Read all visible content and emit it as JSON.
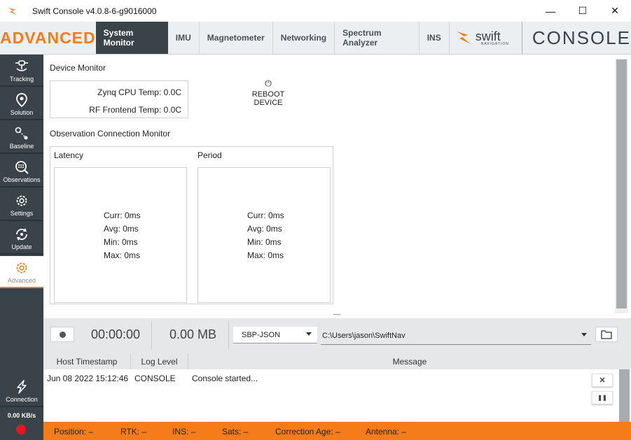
{
  "window": {
    "title": "Swift Console v4.0.8-6-g9016000",
    "minimize": "—",
    "maximize": "☐",
    "close": "✕"
  },
  "topnav": {
    "mode": "ADVANCED",
    "tabs": [
      {
        "label": "System Monitor",
        "active": true
      },
      {
        "label": "IMU"
      },
      {
        "label": "Magnetometer"
      },
      {
        "label": "Networking"
      },
      {
        "label": "Spectrum Analyzer"
      },
      {
        "label": "INS"
      }
    ],
    "logo_word": "swift",
    "logo_sub": "NAVIGATION",
    "console_word": "CONSOLE"
  },
  "sidebar": {
    "items": [
      {
        "label": "Tracking",
        "icon": "satellite-icon"
      },
      {
        "label": "Solution",
        "icon": "map-pin-icon"
      },
      {
        "label": "Baseline",
        "icon": "baseline-icon"
      },
      {
        "label": "Observations",
        "icon": "observations-icon"
      },
      {
        "label": "Settings",
        "icon": "gear-icon"
      },
      {
        "label": "Update",
        "icon": "update-icon"
      },
      {
        "label": "Advanced",
        "icon": "advanced-gear-icon",
        "active": true
      },
      {
        "label": "Connection",
        "icon": "connection-icon"
      }
    ],
    "speed": "0.00 KB/s"
  },
  "device_monitor": {
    "title": "Device Monitor",
    "zynq_temp": "Zynq CPU Temp: 0.0C",
    "rf_temp": "RF Frontend Temp: 0.0C",
    "reboot_label": "REBOOT DEVICE",
    "reboot_icon": "⏻"
  },
  "obs_monitor": {
    "title": "Observation Connection Monitor",
    "latency": {
      "title": "Latency",
      "curr": "Curr: 0ms",
      "avg": "Avg: 0ms",
      "min": "Min: 0ms",
      "max": "Max: 0ms"
    },
    "period": {
      "title": "Period",
      "curr": "Curr: 0ms",
      "avg": "Avg: 0ms",
      "min": "Min: 0ms",
      "max": "Max: 0ms"
    }
  },
  "recording": {
    "timer": "00:00:00",
    "size": "0.00 MB",
    "format": "SBP-JSON",
    "path": "C:\\Users\\jason\\SwiftNav"
  },
  "log": {
    "headers": [
      "Host Timestamp",
      "Log Level",
      "Message"
    ],
    "rows": [
      {
        "timestamp": "Jun 08 2022 15:12:46",
        "level": "CONSOLE",
        "message": "Console started..."
      }
    ],
    "clear_icon": "✕",
    "pause_icon": "❚❚"
  },
  "status": {
    "position": "Position: –",
    "rtk": "RTK: –",
    "ins": "INS: –",
    "sats": "Sats: –",
    "correction_age": "Correction Age: –",
    "antenna": "Antenna: –"
  },
  "colors": {
    "accent": "#f57c18",
    "sidebar": "#3a434a",
    "record": "#e8161c"
  }
}
